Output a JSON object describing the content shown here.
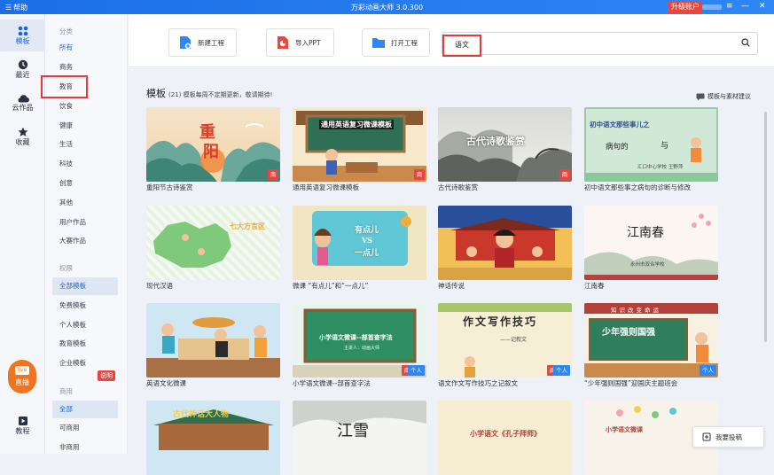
{
  "titlebar": {
    "help": "帮助",
    "title": "万彩动画大师 3.0.300",
    "upgrade": "升级账户"
  },
  "leftnav": [
    {
      "label": "模板",
      "icon": "apps-icon"
    },
    {
      "label": "最近",
      "icon": "clock-icon"
    },
    {
      "label": "云作品",
      "icon": "cloud-icon"
    },
    {
      "label": "收藏",
      "icon": "star-icon"
    }
  ],
  "live": {
    "badge": "live",
    "label": "直播"
  },
  "tutorial": {
    "label": "教程"
  },
  "categories": {
    "header": "分类",
    "items": [
      "所有",
      "商务",
      "教育",
      "饮食",
      "健康",
      "生活",
      "科技",
      "创意",
      "其他",
      "用户作品",
      "大赛作品"
    ]
  },
  "permission": {
    "header": "权限",
    "items": [
      "全部模板",
      "免费模板",
      "个人模板",
      "教育模板",
      "企业模板"
    ]
  },
  "commercial": {
    "header": "商用",
    "explain": "说明",
    "items": [
      "全部",
      "可商用",
      "非商用"
    ]
  },
  "toolbar": {
    "new_project": "新建工程",
    "import_ppt": "导入PPT",
    "open_project": "打开工程"
  },
  "search": {
    "query": "语文"
  },
  "templates_heading": {
    "title": "模板",
    "note": "(21) 模板每周不定期更新，敬请期待!"
  },
  "suggest": "模板与素材建议",
  "feedback": "我要投稿",
  "cards": [
    {
      "title": "重阳节古诗鉴赏",
      "badge": "商"
    },
    {
      "title": "通用英语复习微课模板",
      "badge": "商",
      "thumb": "通用英语复习微课模板"
    },
    {
      "title": "古代诗歌鉴赏",
      "badge": "商",
      "thumb": "古代诗歌鉴赏"
    },
    {
      "title": "初中语文那些事之病句的诊断与修改",
      "thumb": "初中语文那些事儿之",
      "thumb2": "病句的",
      "thumb3": "与",
      "thumb4": "汇口中心学校 王野萍"
    },
    {
      "title": "现代汉语",
      "thumb": "七大方言区"
    },
    {
      "title": "微课 “有点儿”和“一点儿”",
      "thumb": "有点儿",
      "thumb2": "VS",
      "thumb3": "一点儿"
    },
    {
      "title": "神话传说"
    },
    {
      "title": "江南春",
      "thumb": "江南春",
      "thumb2": "永州市双合学校"
    },
    {
      "title": "英语文化微课"
    },
    {
      "title": "小学语文微课--部首查字法",
      "badge": "商",
      "badge2": "个人",
      "thumb": "小学语文微课--部首查字法",
      "thumb2": "主讲人：动画大师"
    },
    {
      "title": "语文作文写作技巧之记叙文",
      "badge": "商",
      "badge2": "个人",
      "thumb": "作文写作技巧",
      "thumb2": "——记叙文"
    },
    {
      "title": "“少年强则国强”迎国庆主题班会",
      "badge2": "个人",
      "thumb": "知识改变命运",
      "thumb2": "少年强则国强"
    },
    {
      "title": "",
      "thumb": "古代神话大人物"
    },
    {
      "title": "",
      "thumb": "江雪"
    },
    {
      "title": "",
      "thumb": "小学语文《孔子拜师》"
    },
    {
      "title": "",
      "thumb": "小学语文微课"
    }
  ]
}
